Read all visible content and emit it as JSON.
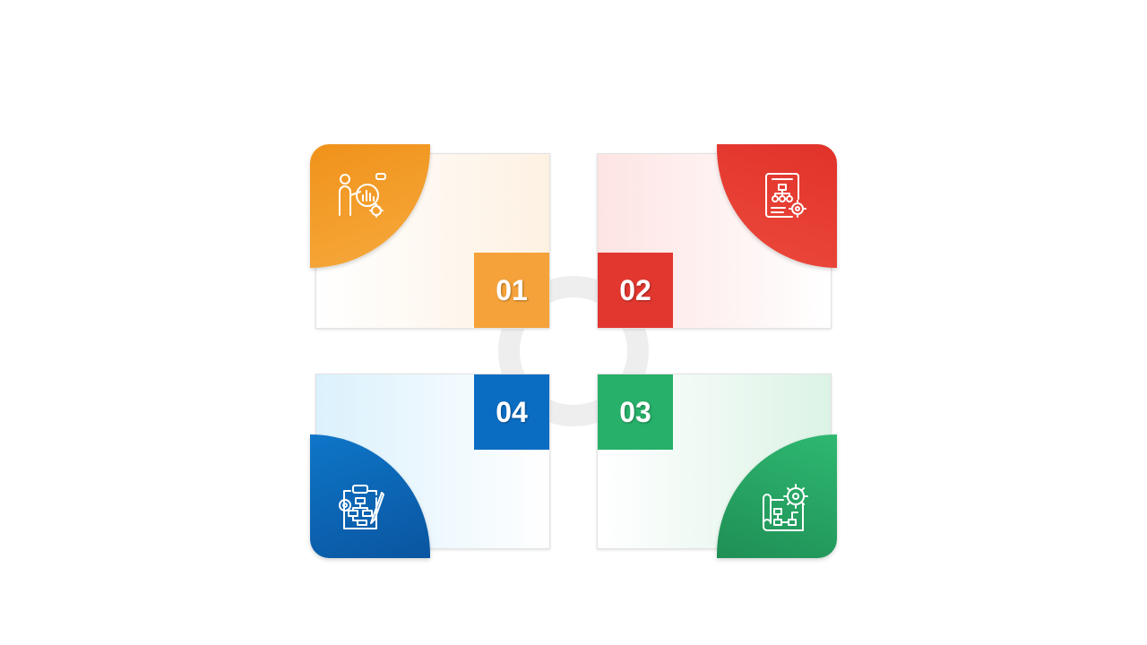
{
  "steps": [
    {
      "number": "01",
      "icon": "analyst-magnifier-chart-icon",
      "color": "#f0961e"
    },
    {
      "number": "02",
      "icon": "document-flowchart-gear-icon",
      "color": "#e33a2f"
    },
    {
      "number": "03",
      "icon": "blueprint-gear-icon",
      "color": "#25a463"
    },
    {
      "number": "04",
      "icon": "clipboard-flowchart-icon",
      "color": "#0b6bbf"
    }
  ],
  "colors": {
    "step1_a": "#f0921a",
    "step1_b": "#f6aa3e",
    "step2_a": "#e1322a",
    "step2_b": "#ec4a3c",
    "step3_a": "#2eb871",
    "step3_b": "#1f8f55",
    "step4_a": "#0e76c8",
    "step4_b": "#0a55a0"
  }
}
